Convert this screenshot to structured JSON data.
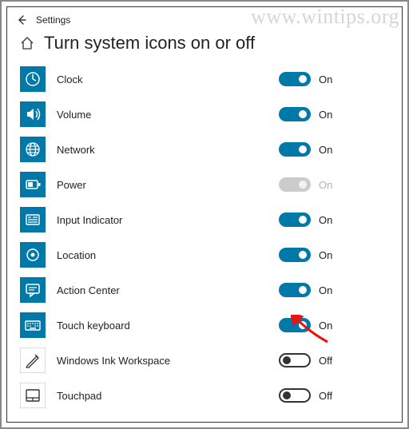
{
  "app_title": "Settings",
  "page_title": "Turn system icons on or off",
  "state_on": "On",
  "state_off": "Off",
  "watermark": "www.wintips.org",
  "accent": "#0078a8",
  "items": [
    {
      "id": "clock",
      "label": "Clock",
      "state": "on",
      "enabled": true,
      "icon": "clock-icon"
    },
    {
      "id": "volume",
      "label": "Volume",
      "state": "on",
      "enabled": true,
      "icon": "volume-icon"
    },
    {
      "id": "network",
      "label": "Network",
      "state": "on",
      "enabled": true,
      "icon": "network-icon"
    },
    {
      "id": "power",
      "label": "Power",
      "state": "on",
      "enabled": false,
      "icon": "power-icon"
    },
    {
      "id": "input-indicator",
      "label": "Input Indicator",
      "state": "on",
      "enabled": true,
      "icon": "input-indicator-icon"
    },
    {
      "id": "location",
      "label": "Location",
      "state": "on",
      "enabled": true,
      "icon": "location-icon"
    },
    {
      "id": "action-center",
      "label": "Action Center",
      "state": "on",
      "enabled": true,
      "icon": "action-center-icon"
    },
    {
      "id": "touch-keyboard",
      "label": "Touch keyboard",
      "state": "on",
      "enabled": true,
      "icon": "touch-keyboard-icon"
    },
    {
      "id": "windows-ink",
      "label": "Windows Ink Workspace",
      "state": "off",
      "enabled": true,
      "icon": "ink-icon"
    },
    {
      "id": "touchpad",
      "label": "Touchpad",
      "state": "off",
      "enabled": true,
      "icon": "touchpad-icon"
    }
  ]
}
